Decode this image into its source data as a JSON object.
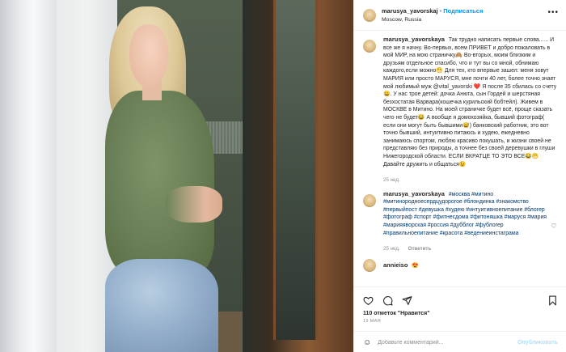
{
  "post": {
    "username": "marusya_yavorskaj",
    "follow_label": "Подписаться",
    "location": "Moscow, Russia",
    "more_label": "•••"
  },
  "comments": [
    {
      "username": "marusya_yavorskaya",
      "text": "Так трудно написать первые слова...... И все же я начну. Во-первых, всем ПРИВЕТ и добро пожаловать в мой МИР, на мою страничку🙈 Во-вторых, моим близким и друзьям отдельное спасибо, что и тут вы со мной, обнимаю каждого,если можно😁 Для тех, кто впервые зашел: меня зовут МАРИЯ или просто МАРУСЯ, мне почти 40 лет, более точно знает мой любимый муж @vital_yavorski ❤️ Я после 35 сбилась со счету😄. У нас трое детей: дочка Анюта, сын Гордей и шерстяная безхостатая Варвара(кошечка курильский бобтейл). Живем в МОСКВЕ в Митино. На моей страничке будет всё, проще сказать чего не будет😂 А вообще я домохозяйка, бывший фотограф( если они могут быть бывшими😅) банковский работник, это вот точно бывший, интуитивно питаюсь и худею, ежедневно занимаюсь спортом, люблю красиво покушать, и жизни своей не представляю без природы, а точнее без своей деревушки в глуши Нижегородской области. ЕСЛИ ВКРАТЦЕ ТО ЭТО ВСЕ😂😁 Давайте дружить и общаться😉",
      "time": "25 нед."
    },
    {
      "username": "marusya_yavorskaya",
      "text": "#москва #митино #митинородноесердцудорогое #блондинка #знакомство #первыйпост #девушка #худею #интуитивноепитание #блогер #фотограф #спорт #фитнесдома #фитоняшка #маруся #мария #марияяворская #россия #дубблог #фублогер #правильноепитание #красота #ведениеинстаграма",
      "time": "25 нед.",
      "reply_label": "Ответить"
    },
    {
      "username": "annieiso",
      "text": "😍"
    }
  ],
  "actions": {
    "likes": "110 отметок \"Нравится\"",
    "date": "19 МАЯ",
    "comment_placeholder": "Добавьте комментарий...",
    "publish_label": "Опубликовать",
    "emoji_icon": "smiley-icon"
  }
}
